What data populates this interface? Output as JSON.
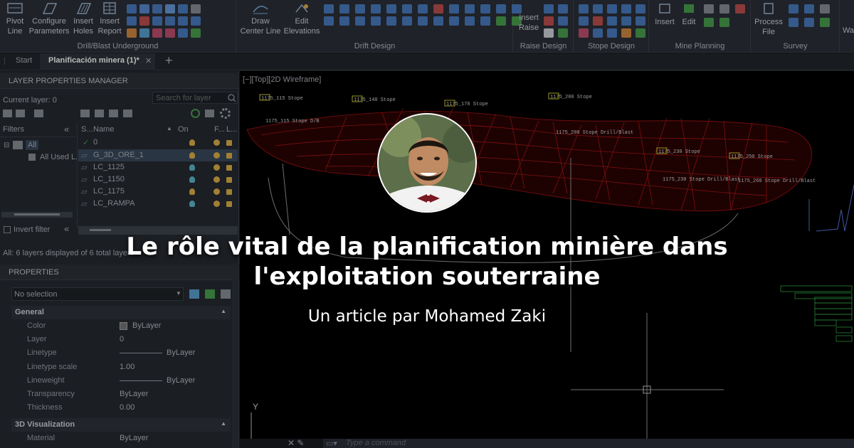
{
  "ribbon": {
    "buttons": [
      {
        "label": "Pivot\nLine"
      },
      {
        "label": "Configure\nParameters"
      },
      {
        "label": "Insert\nHoles"
      },
      {
        "label": "Insert\nReport"
      },
      {
        "label": "Draw\nCenter Line"
      },
      {
        "label": "Edit\nElevations"
      },
      {
        "label": "Insert\nRaise"
      },
      {
        "label": "Insert"
      },
      {
        "label": "Edit"
      },
      {
        "label": "Process\nFile"
      },
      {
        "label": "Wa"
      }
    ],
    "groups": [
      "Drill/Blast Underground",
      "Drift Design",
      "Raise Design",
      "Stope Design",
      "Mine Planning",
      "Survey"
    ]
  },
  "tabs": {
    "start": "Start",
    "active": "Planificación minera (1)*",
    "close": "✕",
    "add": "+"
  },
  "layer_manager": {
    "title": "LAYER PROPERTIES MANAGER",
    "current_layer": "Current layer: 0",
    "search_placeholder": "Search for layer",
    "filters_label": "Filters",
    "filter_all": "All",
    "filter_all_used": "All Used L...",
    "columns": [
      "S...",
      "Name",
      "On",
      "F...",
      "L..."
    ],
    "layers": [
      {
        "name": "0",
        "bulb": "#e0b24a"
      },
      {
        "name": "G_3D_ORE_1",
        "bulb": "#e0b24a"
      },
      {
        "name": "LC_1125",
        "bulb": "#5fb8c8"
      },
      {
        "name": "LC_1150",
        "bulb": "#5fb8c8"
      },
      {
        "name": "LC_1175",
        "bulb": "#e0b24a"
      },
      {
        "name": "LC_RAMPA",
        "bulb": "#5fb8c8"
      }
    ],
    "invert_filter": "Invert filter",
    "status": "All: 6 layers displayed of 6 total layers"
  },
  "properties": {
    "title": "PROPERTIES",
    "selection": "No selection",
    "general_section": "General",
    "rows": [
      {
        "key": "Color",
        "value": "ByLayer"
      },
      {
        "key": "Layer",
        "value": "0"
      },
      {
        "key": "Linetype",
        "value": "ByLayer"
      },
      {
        "key": "Linetype scale",
        "value": "1.00"
      },
      {
        "key": "Lineweight",
        "value": "ByLayer"
      },
      {
        "key": "Transparency",
        "value": "ByLayer"
      },
      {
        "key": "Thickness",
        "value": "0.00"
      }
    ],
    "viz_section": "3D Visualization",
    "material_key": "Material",
    "material_value": "ByLayer"
  },
  "viewport": {
    "label": "[−][Top][2D Wireframe]",
    "command_placeholder": "Type a command",
    "annotations": [
      "1175_115 Stope",
      "1175_140 Stope",
      "1175_170 Stope",
      "1175_200 Stope",
      "1175_115 Stope D/B",
      "1175_200 Stope Drill/Blast",
      "1175_230 Stope",
      "1175_230 Stope Drill/Blast",
      "1175_250 Stope",
      "1175_260 Stope Drill/Blast"
    ]
  },
  "overlay": {
    "headline_line1": "Le rôle vital de la planification minière dans",
    "headline_line2": "l'exploitation souterraine",
    "byline": "Un article par Mohamed Zaki"
  },
  "colors": {
    "ore": "#b01515",
    "ribbon_bg": "#2b3038",
    "panel_bg": "#262a31"
  }
}
